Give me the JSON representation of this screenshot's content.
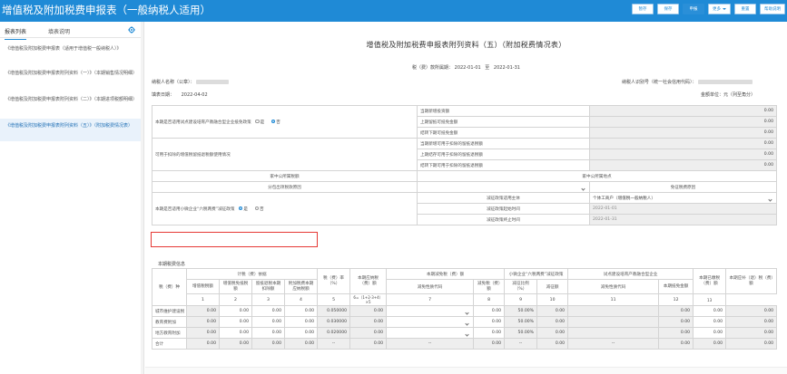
{
  "app": {
    "title": "增值税及附加税费申报表（一般纳税人适用）",
    "buttons": [
      {
        "label": "暂存",
        "active": false
      },
      {
        "label": "保存",
        "active": false
      },
      {
        "label": "申报",
        "active": true
      },
      {
        "label": "更多",
        "active": false,
        "dropdown": true
      },
      {
        "label": "重置",
        "active": false
      },
      {
        "label": "帮助说明",
        "active": false
      }
    ],
    "colors": {
      "header": "#1f8ad6",
      "active_item": "#e9f2fb",
      "highlight": "#e53935"
    }
  },
  "sidebar": {
    "tabs": [
      "报表列表",
      "填表说明"
    ],
    "settings_icon": "gear-icon",
    "items": [
      {
        "label": "《增值税及附加税费申报表（适用于增值税一般纳税人）》",
        "active": false
      },
      {
        "label": "《增值税及附加税费申报表附列资料（一）》（本期销售情况明细）",
        "active": false
      },
      {
        "label": "《增值税及附加税费申报表附列资料（二）》（本期进项税额明细）",
        "active": false
      },
      {
        "label": "《增值税及附加税费申报表附列资料（五）》（附加税费情况表）",
        "active": true
      }
    ]
  },
  "main": {
    "title": "增值税及附加税费申报表附列资料（五）（附加税费情况表）",
    "period_label": "税（费）款所属期：",
    "period_start": "2022-01-01",
    "period_to": "至",
    "period_end": "2022-01-31",
    "taxpayer_name_label": "纳税人名称（公章）：",
    "taxpayer_id_label": "纳税人识别号（统一社会信用代码）：",
    "fill_date_label": "填表日期：",
    "fill_date": "2022-04-02",
    "unit_label": "金额单位：元（列至角分）",
    "upper": {
      "q1_label": "本期是否适用试点建设培育产教融合型企业抵免政策",
      "q1_yes": "是",
      "q1_no": "否",
      "q1_rows": [
        {
          "label": "当期新增投资额",
          "value": "0.00"
        },
        {
          "label": "上期留抵可抵免金额",
          "value": "0.00"
        },
        {
          "label": "结转下期可抵免金额",
          "value": "0.00"
        }
      ],
      "q2_label": "可用于扣除的增值税留抵退税额使用情况",
      "q2_rows": [
        {
          "label": "当期新增可用于扣除的留抵退税额",
          "value": "0.00"
        },
        {
          "label": "上期结存可用于扣除的留抵退税额",
          "value": "0.00"
        },
        {
          "label": "结转下期可用于扣除的留抵退税额",
          "value": "0.00"
        }
      ],
      "row_a_left": "家中公所属税额",
      "row_a_right": "家中公所属地点",
      "row_b_left": "分包出项税款原因",
      "row_b_right": "免征税费原因",
      "q3_label": "本期是否适用小微企业“六税两费”减征政策",
      "q3_yes": "是",
      "q3_no": "否",
      "q3_rows": [
        {
          "label": "减征政策适用主体",
          "value": "个体工商户（增值税一般纳税人）",
          "select": true
        },
        {
          "label": "减征政策起始时间",
          "value": "2022-01-01"
        },
        {
          "label": "减征政策终止时间",
          "value": "2022-01-31"
        }
      ]
    },
    "calc_label": "本期税费信息",
    "lower": {
      "h_col0": "税（费）种",
      "h_group1": "计税（费）依据",
      "h_g1_cols": [
        "增值税税额",
        "增值税免抵税额",
        "留抵退税本期扣除额",
        "附加税费本期应纳税额"
      ],
      "h_rate": "税（费）率（%）",
      "h_due": "本期应纳税（费）额",
      "h_group2": "本期减免税（费）额",
      "h_g2_cols": [
        "减免性质代码",
        "减免税（费）额"
      ],
      "h_group3": "小微企业“六税两费”减征政策",
      "h_g3_cols": [
        "减征比例（%）",
        "减征额"
      ],
      "h_group4": "试点建设培育产教融合型企业",
      "h_g4_cols": [
        "减免性质代码",
        "本期抵免金额"
      ],
      "h_paid": "本期已缴税（费）额",
      "h_refund": "本期应补（退）税（费）额",
      "col_nums": [
        "1",
        "2",
        "3",
        "4",
        "5",
        "6=（1+2-3+4）×5",
        "7",
        "8",
        "9",
        "10",
        "11",
        "12",
        "13",
        "14=6-8-10-12-13"
      ],
      "rows": [
        {
          "name": "城市维护建设税",
          "v1": "0.00",
          "v2": "0.00",
          "v3": "0.00",
          "v4": "0.00",
          "rate": "0.050000",
          "due": "0.00",
          "code": "",
          "relief": "0.00",
          "pct": "50.00%",
          "cut": "0.00",
          "code2": "",
          "credit": "0.00",
          "paid": "0.00",
          "refund": "0.00"
        },
        {
          "name": "教育费附加",
          "v1": "0.00",
          "v2": "0.00",
          "v3": "0.00",
          "v4": "0.00",
          "rate": "0.030000",
          "due": "0.00",
          "code": "",
          "relief": "0.00",
          "pct": "50.00%",
          "cut": "0.00",
          "code2": "",
          "credit": "0.00",
          "paid": "0.00",
          "refund": "0.00"
        },
        {
          "name": "地方教育附加",
          "v1": "0.00",
          "v2": "0.00",
          "v3": "0.00",
          "v4": "0.00",
          "rate": "0.020000",
          "due": "0.00",
          "code": "",
          "relief": "0.00",
          "pct": "50.00%",
          "cut": "0.00",
          "code2": "",
          "credit": "0.00",
          "paid": "0.00",
          "refund": "0.00"
        },
        {
          "name": "合计",
          "v1": "0.00",
          "v2": "0.00",
          "v3": "0.00",
          "v4": "0.00",
          "rate": "--",
          "due": "0.00",
          "code": "--",
          "relief": "0.00",
          "pct": "--",
          "cut": "0.00",
          "code2": "--",
          "credit": "0.00",
          "paid": "0.00",
          "refund": "0.00"
        }
      ]
    }
  }
}
